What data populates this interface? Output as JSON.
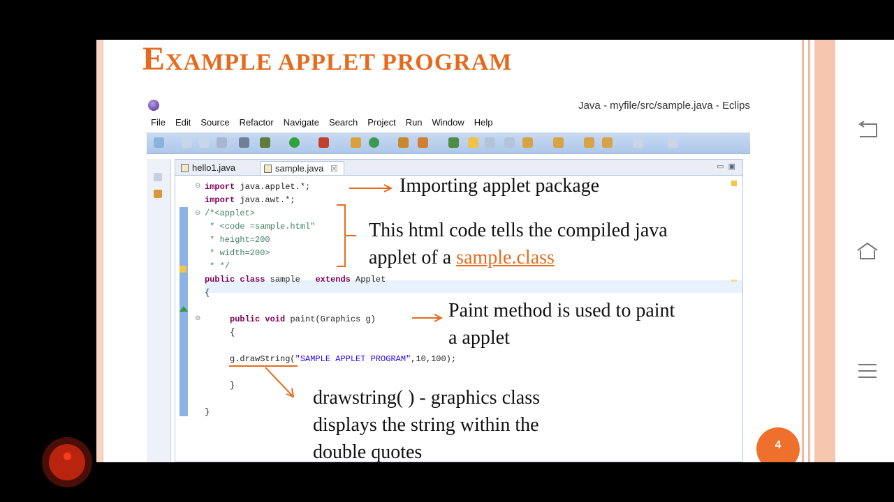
{
  "slide": {
    "title_first": "E",
    "title_rest": "xample applet program",
    "page_number": "4"
  },
  "eclipse": {
    "window_title": "Java - myfile/src/sample.java - Eclips",
    "menu": [
      "File",
      "Edit",
      "Source",
      "Refactor",
      "Navigate",
      "Search",
      "Project",
      "Run",
      "Window",
      "Help"
    ],
    "tabs": [
      {
        "label": "hello1.java"
      },
      {
        "label": "sample.java",
        "close": "☒"
      }
    ]
  },
  "code": {
    "l1a": "import",
    "l1b": " java.applet.*;",
    "l2a": "import",
    "l2b": " java.awt.*;",
    "l3": "/*<applet>",
    "l4": " * <code =sample.html\"",
    "l5": " * height=200",
    "l6": " * width=200>",
    "l7": " * */",
    "l8a": "public class",
    "l8b": " sample   ",
    "l8c": "extends",
    "l8d": " Applet",
    "l9": "{",
    "l10a": "public void",
    "l10b": " paint(Graphics g)",
    "l11": "{",
    "l12a": "g.drawString(",
    "l12b": "\"SAMPLE APPLET PROGRAM\"",
    "l12c": ",10,100);",
    "l13": "}",
    "l14": "}"
  },
  "annotations": {
    "import_note": "Importing applet package",
    "html_note_line1": "This html code tells the compiled java",
    "html_note_line2_prefix": "applet of a ",
    "html_note_link": "sample.class",
    "paint_note_line1": "Paint method is used to paint",
    "paint_note_line2": "a applet",
    "draw_note_line1": "drawstring( ) - graphics class",
    "draw_note_line2": "displays the string within the",
    "draw_note_line3": "double quotes"
  },
  "colors": {
    "accent": "#e46b1e",
    "keyword": "#7f0055",
    "comment": "#3f7f5f",
    "string": "#2a00ff"
  },
  "sidenav": {
    "icons": [
      "back-icon",
      "home-icon",
      "menu-icon"
    ]
  }
}
